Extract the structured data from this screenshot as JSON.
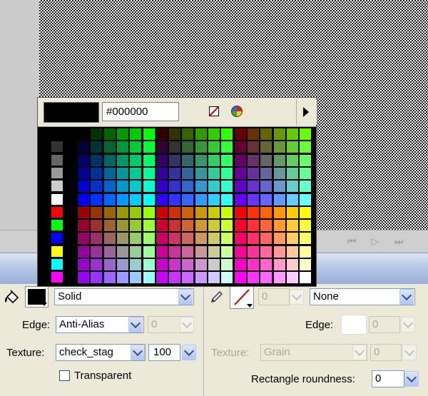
{
  "popup": {
    "hex_value": "#000000",
    "preview_color": "#000000"
  },
  "properties": {
    "fill_color": "#000000",
    "fill_type": "Solid",
    "edge_label": "Edge:",
    "edge_value": "Anti-Alias",
    "edge_number": "0",
    "texture_label": "Texture:",
    "texture_value": "check_stag",
    "texture_percent": "100",
    "transparent_label": "Transparent",
    "transparent_checked": false,
    "stroke_number": "0",
    "stroke_style": "None",
    "stroke_edge_label": "Edge:",
    "stroke_edge_number": "0",
    "stroke_texture_label": "Texture:",
    "stroke_texture_value": "Grain",
    "stroke_texture_number": "0",
    "roundness_label": "Rectangle roundness:",
    "roundness_value": "0"
  },
  "icons": {
    "fill": "paint-bucket-icon",
    "stroke": "pencil-icon",
    "no_color": "no-color-icon",
    "color_wheel": "color-wheel-icon",
    "popup_menu": "triangle-right-icon",
    "timeline": [
      "previous-frame-icon",
      "play-icon",
      "next-frame-icon"
    ]
  },
  "left_column_colors": [
    "#000000",
    "#333333",
    "#666666",
    "#999999",
    "#cccccc",
    "#ffffff",
    "#ff0000",
    "#00ff00",
    "#0000ff",
    "#ffff00",
    "#00ffff",
    "#ff00ff"
  ]
}
